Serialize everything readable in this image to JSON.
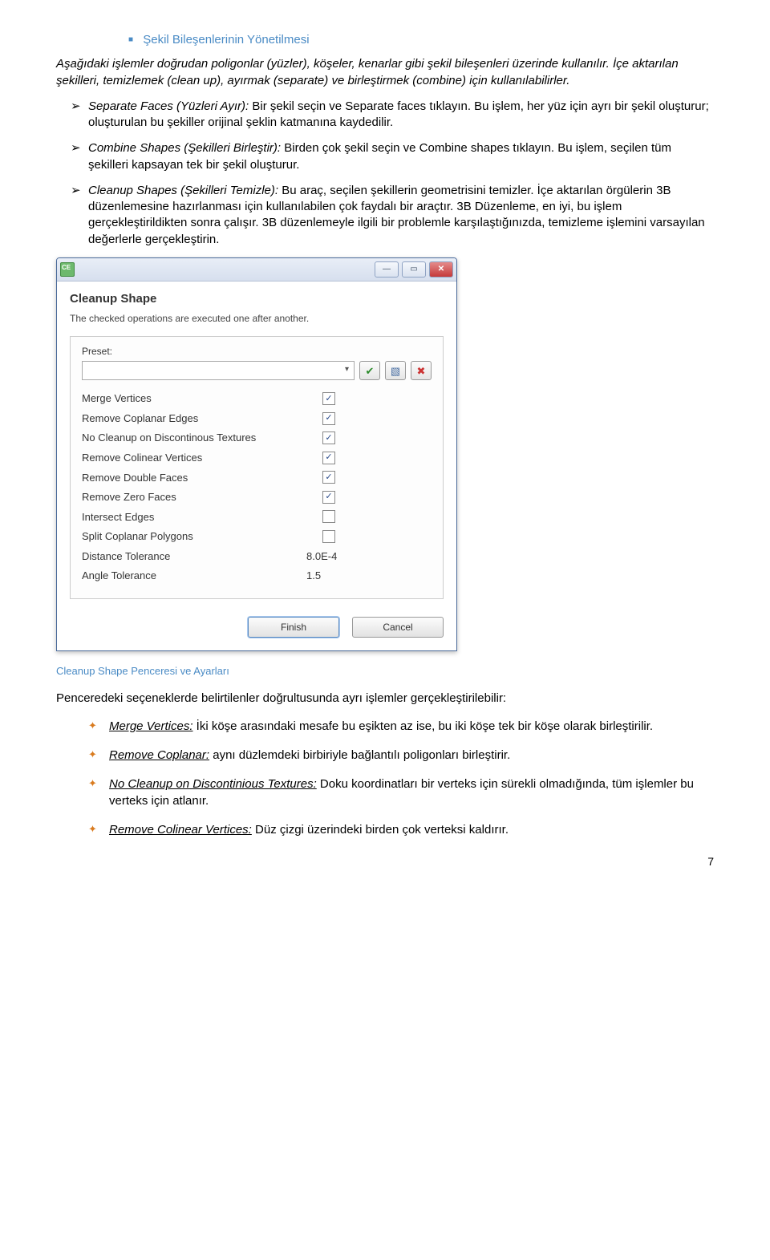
{
  "section_title": "Şekil Bileşenlerinin Yönetilmesi",
  "intro": "Aşağıdaki işlemler doğrudan poligonlar (yüzler), köşeler, kenarlar gibi şekil bileşenleri üzerinde kullanılır. İçe aktarılan şekilleri, temizlemek (clean up), ayırmak (separate) ve birleştirmek (combine) için kullanılabilirler.",
  "arrow_items": [
    {
      "lead": "Separate Faces (Yüzleri Ayır):",
      "rest": " Bir şekil seçin ve Separate faces tıklayın. Bu işlem, her yüz için ayrı bir şekil oluşturur; oluşturulan bu şekiller orijinal şeklin katmanına kaydedilir."
    },
    {
      "lead": "Combine Shapes (Şekilleri Birleştir):",
      "rest": " Birden çok şekil seçin ve Combine shapes tıklayın. Bu işlem, seçilen tüm şekilleri kapsayan tek bir şekil oluşturur."
    },
    {
      "lead": "Cleanup Shapes (Şekilleri Temizle):",
      "rest": " Bu araç, seçilen şekillerin geometrisini temizler. İçe aktarılan örgülerin 3B düzenlemesine hazırlanması için kullanılabilen çok faydalı bir araçtır. 3B Düzenleme, en iyi, bu işlem gerçekleştirildikten sonra çalışır. 3B düzenlemeyle ilgili bir problemle karşılaştığınızda, temizleme işlemini varsayılan değerlerle gerçekleştirin."
    }
  ],
  "dialog": {
    "title": "Cleanup Shape",
    "subtitle": "The checked operations are executed one after another.",
    "preset_label": "Preset:",
    "options": [
      {
        "label": "Merge Vertices",
        "checked": true
      },
      {
        "label": "Remove Coplanar Edges",
        "checked": true
      },
      {
        "label": "No Cleanup on Discontinous Textures",
        "checked": true
      },
      {
        "label": "Remove Colinear Vertices",
        "checked": true
      },
      {
        "label": "Remove Double Faces",
        "checked": true
      },
      {
        "label": "Remove Zero Faces",
        "checked": true
      },
      {
        "label": "Intersect Edges",
        "checked": false
      },
      {
        "label": "Split Coplanar Polygons",
        "checked": false
      }
    ],
    "values": [
      {
        "label": "Distance Tolerance",
        "value": "8.0E-4"
      },
      {
        "label": "Angle Tolerance",
        "value": "1.5"
      }
    ],
    "finish": "Finish",
    "cancel": "Cancel"
  },
  "caption": "Cleanup Shape Penceresi ve Ayarları",
  "post_text": "Penceredeki seçeneklerde belirtilenler doğrultusunda ayrı işlemler gerçekleştirilebilir:",
  "star_items": [
    {
      "lead": "Merge Vertices:",
      "rest": " İki köşe arasındaki mesafe bu eşikten az ise, bu iki köşe tek bir köşe olarak birleştirilir."
    },
    {
      "lead": "Remove Coplanar:",
      "rest": " aynı düzlemdeki birbiriyle bağlantılı poligonları birleştirir."
    },
    {
      "lead": "No Cleanup on Discontinious Textures:",
      "rest": " Doku koordinatları bir verteks için sürekli olmadığında, tüm işlemler bu verteks için atlanır."
    },
    {
      "lead": "Remove Colinear Vertices:",
      "rest": " Düz çizgi üzerindeki birden çok verteksi kaldırır."
    }
  ],
  "page_number": "7"
}
